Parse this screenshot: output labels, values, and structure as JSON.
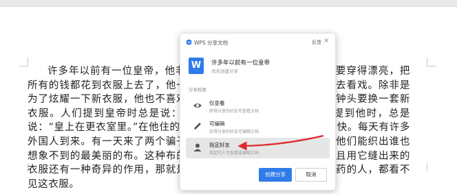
{
  "document": {
    "paragraph": "许多年以前有一位皇帝，他非常喜欢穿好看的新衣服。他为了要穿得漂亮，把所有的钱都花到衣服上去了，他一点也不关心他的军队，也不喜欢去看戏。除非是为了炫耀一下新衣服，他也不喜欢乘着马车去逛公园。他每天每个钟头要换一套新衣服。人们提到皇帝时总是说：“皇上在会议室里。”但是人们一提到他时，总是说：“皇上在更衣室里。”在他住的那个大城市里，生活很轻松，很愉快。每天有许多外国人到来。有一天来了两个骗子。他们说他们是织工。他们说，他们能织出谁也想象不到的最美丽的布。这种布的色彩和图案不仅是非常好看，而且用它缝出来的衣服还有一种奇异的作用，那就是凡是不称职的或者愚蠢得不可救药的人，都看不见这衣服。"
  },
  "dialog": {
    "title": "WPS 分享文档",
    "feedback": "反馈",
    "close": "×",
    "file": {
      "icon_letter": "W",
      "name": "许多年以前有一位皇帝",
      "status": "尚未创建分享"
    },
    "permission_label": "分享权限",
    "permissions": [
      {
        "icon": "eye-icon",
        "title": "仅查看",
        "desc": "获得分享的好友可查看文档"
      },
      {
        "icon": "pencil-icon",
        "title": "可编辑",
        "desc": "获得分享的好友可编辑文档"
      },
      {
        "icon": "user-icon",
        "title": "指定好友",
        "desc": "指定的人可查看或编辑文档",
        "selected": true
      }
    ],
    "create_button": "创建分享",
    "cancel_button": "取消"
  },
  "colors": {
    "accent": "#2f7bea",
    "annotation_arrow": "#e0282e",
    "selected_row": "#e6e6e6"
  }
}
